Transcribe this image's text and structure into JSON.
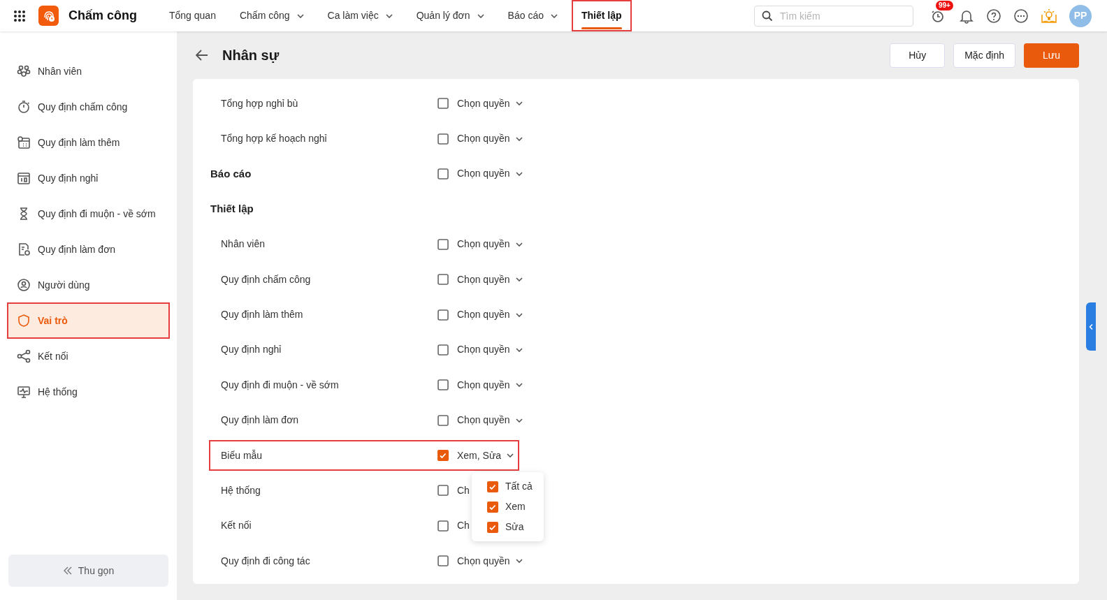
{
  "app": {
    "title": "Chấm công"
  },
  "nav": [
    {
      "label": "Tổng quan",
      "dropdown": false,
      "selected": false,
      "highlighted": false
    },
    {
      "label": "Chấm công",
      "dropdown": true,
      "selected": false,
      "highlighted": false
    },
    {
      "label": "Ca làm việc",
      "dropdown": true,
      "selected": false,
      "highlighted": false
    },
    {
      "label": "Quản lý đơn",
      "dropdown": true,
      "selected": false,
      "highlighted": false
    },
    {
      "label": "Báo cáo",
      "dropdown": true,
      "selected": false,
      "highlighted": false
    },
    {
      "label": "Thiết lập",
      "dropdown": false,
      "selected": true,
      "highlighted": true
    }
  ],
  "search": {
    "placeholder": "Tìm kiếm"
  },
  "notification_badge": "99+",
  "avatar": "PP",
  "sidebar": {
    "items": [
      {
        "label": "Nhân viên",
        "selected": false,
        "highlighted": false
      },
      {
        "label": "Quy định chấm công",
        "selected": false,
        "highlighted": false
      },
      {
        "label": "Quy định làm thêm",
        "selected": false,
        "highlighted": false
      },
      {
        "label": "Quy định nghỉ",
        "selected": false,
        "highlighted": false
      },
      {
        "label": "Quy định đi muộn - về sớm",
        "selected": false,
        "highlighted": false
      },
      {
        "label": "Quy định làm đơn",
        "selected": false,
        "highlighted": false
      },
      {
        "label": "Người dùng",
        "selected": false,
        "highlighted": false
      },
      {
        "label": "Vai trò",
        "selected": true,
        "highlighted": true
      },
      {
        "label": "Kết nối",
        "selected": false,
        "highlighted": false
      },
      {
        "label": "Hệ thống",
        "selected": false,
        "highlighted": false
      }
    ],
    "collapse": "Thu gọn"
  },
  "page": {
    "title": "Nhân sự",
    "buttons": [
      {
        "label": "Hủy",
        "kind": "secondary"
      },
      {
        "label": "Mặc định",
        "kind": "secondary"
      },
      {
        "label": "Lưu",
        "kind": "primary"
      }
    ]
  },
  "rows": [
    {
      "kind": "item",
      "label": "Tổng hợp nghỉ bù",
      "checked": false,
      "permission": "Chọn quyền",
      "caret": true,
      "highlighted": false
    },
    {
      "kind": "item",
      "label": "Tổng hợp kế hoạch nghỉ",
      "checked": false,
      "permission": "Chọn quyền",
      "caret": true,
      "highlighted": false
    },
    {
      "kind": "section",
      "label": "Báo cáo",
      "checked": false,
      "permission": "Chọn quyền",
      "caret": true,
      "highlighted": false
    },
    {
      "kind": "heading",
      "label": "Thiết lập"
    },
    {
      "kind": "item",
      "label": "Nhân viên",
      "checked": false,
      "permission": "Chọn quyền",
      "caret": true,
      "highlighted": false
    },
    {
      "kind": "item",
      "label": "Quy định chấm công",
      "checked": false,
      "permission": "Chọn quyền",
      "caret": true,
      "highlighted": false
    },
    {
      "kind": "item",
      "label": "Quy định làm thêm",
      "checked": false,
      "permission": "Chọn quyền",
      "caret": true,
      "highlighted": false
    },
    {
      "kind": "item",
      "label": "Quy định nghỉ",
      "checked": false,
      "permission": "Chọn quyền",
      "caret": true,
      "highlighted": false
    },
    {
      "kind": "item",
      "label": "Quy định đi muộn - về sớm",
      "checked": false,
      "permission": "Chọn quyền",
      "caret": true,
      "highlighted": false
    },
    {
      "kind": "item",
      "label": "Quy định làm đơn",
      "checked": false,
      "permission": "Chọn quyền",
      "caret": true,
      "highlighted": false
    },
    {
      "kind": "item",
      "label": "Biểu mẫu",
      "checked": true,
      "permission": "Xem, Sửa",
      "caret": true,
      "highlighted": true
    },
    {
      "kind": "item",
      "label": "Hệ thống",
      "checked": false,
      "permission": "Ch",
      "caret": false,
      "highlighted": false
    },
    {
      "kind": "item",
      "label": "Kết nối",
      "checked": false,
      "permission": "Ch",
      "caret": false,
      "highlighted": false
    },
    {
      "kind": "item",
      "label": "Quy định đi công tác",
      "checked": false,
      "permission": "Chọn quyền",
      "caret": true,
      "highlighted": false
    }
  ],
  "permission_menu": [
    {
      "label": "Tất cả",
      "checked": true
    },
    {
      "label": "Xem",
      "checked": true
    },
    {
      "label": "Sửa",
      "checked": true
    }
  ]
}
